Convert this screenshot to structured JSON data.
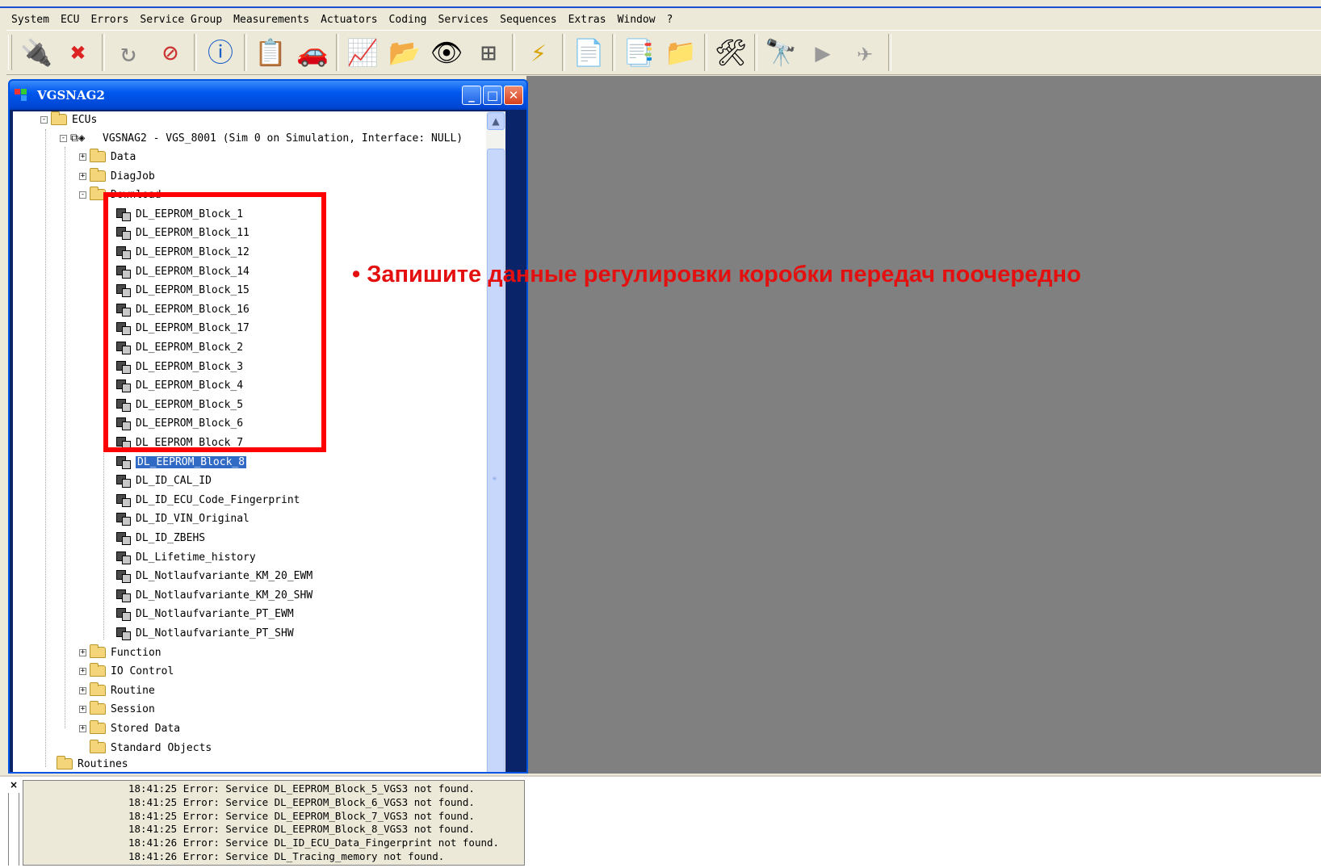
{
  "menu": [
    "System",
    "ECU",
    "Errors",
    "Service Group",
    "Measurements",
    "Actuators",
    "Coding",
    "Services",
    "Sequences",
    "Extras",
    "Window",
    "?"
  ],
  "toolbar_icons": [
    "connect-icon",
    "disconnect-icon",
    "refresh-icon",
    "no-refresh-icon",
    "info-icon",
    "report-icon",
    "vehicle-icon",
    "graph-icon",
    "export-icon",
    "eye-icon",
    "network-icon",
    "flash-icon",
    "document-icon",
    "table-icon",
    "import-icon",
    "tools-icon",
    "binoculars-icon",
    "plug-icon",
    "unplug-icon"
  ],
  "window": {
    "title": "VGSNAG2",
    "min": "_",
    "max": "□",
    "close": "✕"
  },
  "tree": {
    "root": "ECUs",
    "ecu": "VGSNAG2 - VGS_8001 (Sim 0 on Simulation, Interface: NULL)",
    "groups_before": [
      "Data",
      "DiagJob"
    ],
    "download_group": "Download",
    "download_items": [
      "DL_EEPROM_Block_1",
      "DL_EEPROM_Block_11",
      "DL_EEPROM_Block_12",
      "DL_EEPROM_Block_14",
      "DL_EEPROM_Block_15",
      "DL_EEPROM_Block_16",
      "DL_EEPROM_Block_17",
      "DL_EEPROM_Block_2",
      "DL_EEPROM_Block_3",
      "DL_EEPROM_Block_4",
      "DL_EEPROM_Block_5",
      "DL_EEPROM_Block_6",
      "DL_EEPROM_Block_7",
      "DL_EEPROM_Block_8",
      "DL_ID_CAL_ID",
      "DL_ID_ECU_Code_Fingerprint",
      "DL_ID_VIN_Original",
      "DL_ID_ZBEHS",
      "DL_Lifetime_history",
      "DL_Notlaufvariante_KM_20_EWM",
      "DL_Notlaufvariante_KM_20_SHW",
      "DL_Notlaufvariante_PT_EWM",
      "DL_Notlaufvariante_PT_SHW"
    ],
    "selected_index": 13,
    "groups_after": [
      "Function",
      "IO Control",
      "Routine",
      "Session",
      "Stored Data",
      "Standard Objects"
    ],
    "routines": "Routines"
  },
  "annotation": "• Запишите данные регулировки коробки передач поочередно",
  "log": [
    "18:41:25 Error: Service DL_EEPROM_Block_5_VGS3 not found.",
    "18:41:25 Error: Service DL_EEPROM_Block_6_VGS3 not found.",
    "18:41:25 Error: Service DL_EEPROM_Block_7_VGS3 not found.",
    "18:41:25 Error: Service DL_EEPROM_Block_8_VGS3 not found.",
    "18:41:26 Error: Service DL_ID_ECU_Data_Fingerprint not found.",
    "18:41:26 Error: Service DL_Tracing_memory not found."
  ],
  "log_close": "×",
  "colors": {
    "titlebar": "#0058ee",
    "mdi": "#808080",
    "highlight": "#316ac5",
    "annotation": "#e41010"
  }
}
